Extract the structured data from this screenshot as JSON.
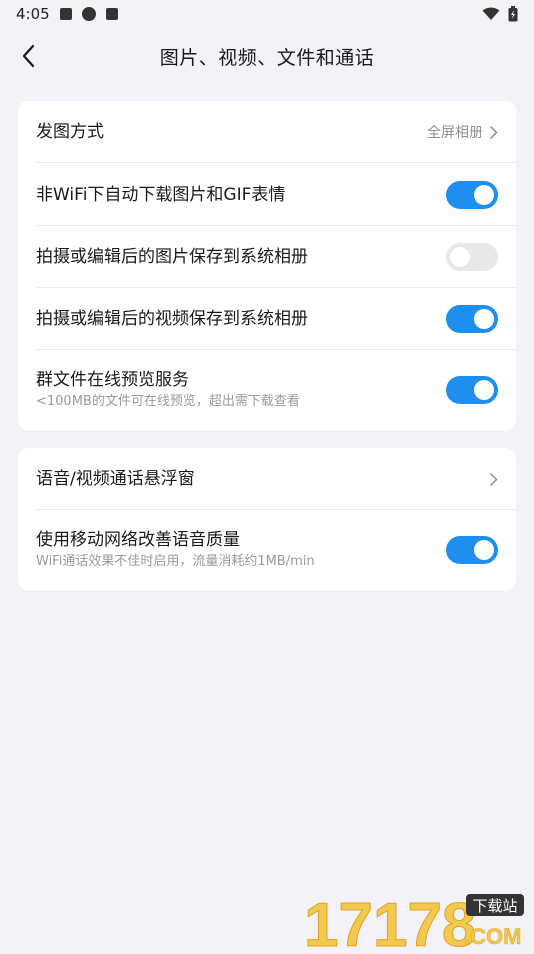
{
  "status_bar": {
    "time": "4:05"
  },
  "nav": {
    "title": "图片、视频、文件和通话"
  },
  "settings_group_1": {
    "send_image_mode": {
      "label": "发图方式",
      "value": "全屏相册"
    },
    "auto_download": {
      "label": "非WiFi下自动下载图片和GIF表情",
      "enabled": true
    },
    "save_photo": {
      "label": "拍摄或编辑后的图片保存到系统相册",
      "enabled": false
    },
    "save_video": {
      "label": "拍摄或编辑后的视频保存到系统相册",
      "enabled": true
    },
    "file_preview": {
      "label": "群文件在线预览服务",
      "subtitle": "<100MB的文件可在线预览，超出需下载查看",
      "enabled": true
    }
  },
  "settings_group_2": {
    "float_window": {
      "label": "语音/视频通话悬浮窗"
    },
    "mobile_network": {
      "label": "使用移动网络改善语音质量",
      "subtitle": "WiFi通话效果不佳时启用，流量消耗约1MB/min",
      "enabled": true
    }
  },
  "colors": {
    "accent": "#1e8fef",
    "background": "#f2f2f7",
    "card": "#ffffff"
  },
  "watermark": {
    "number": "17178",
    "tag": "下载站",
    "domain": ".COM"
  }
}
